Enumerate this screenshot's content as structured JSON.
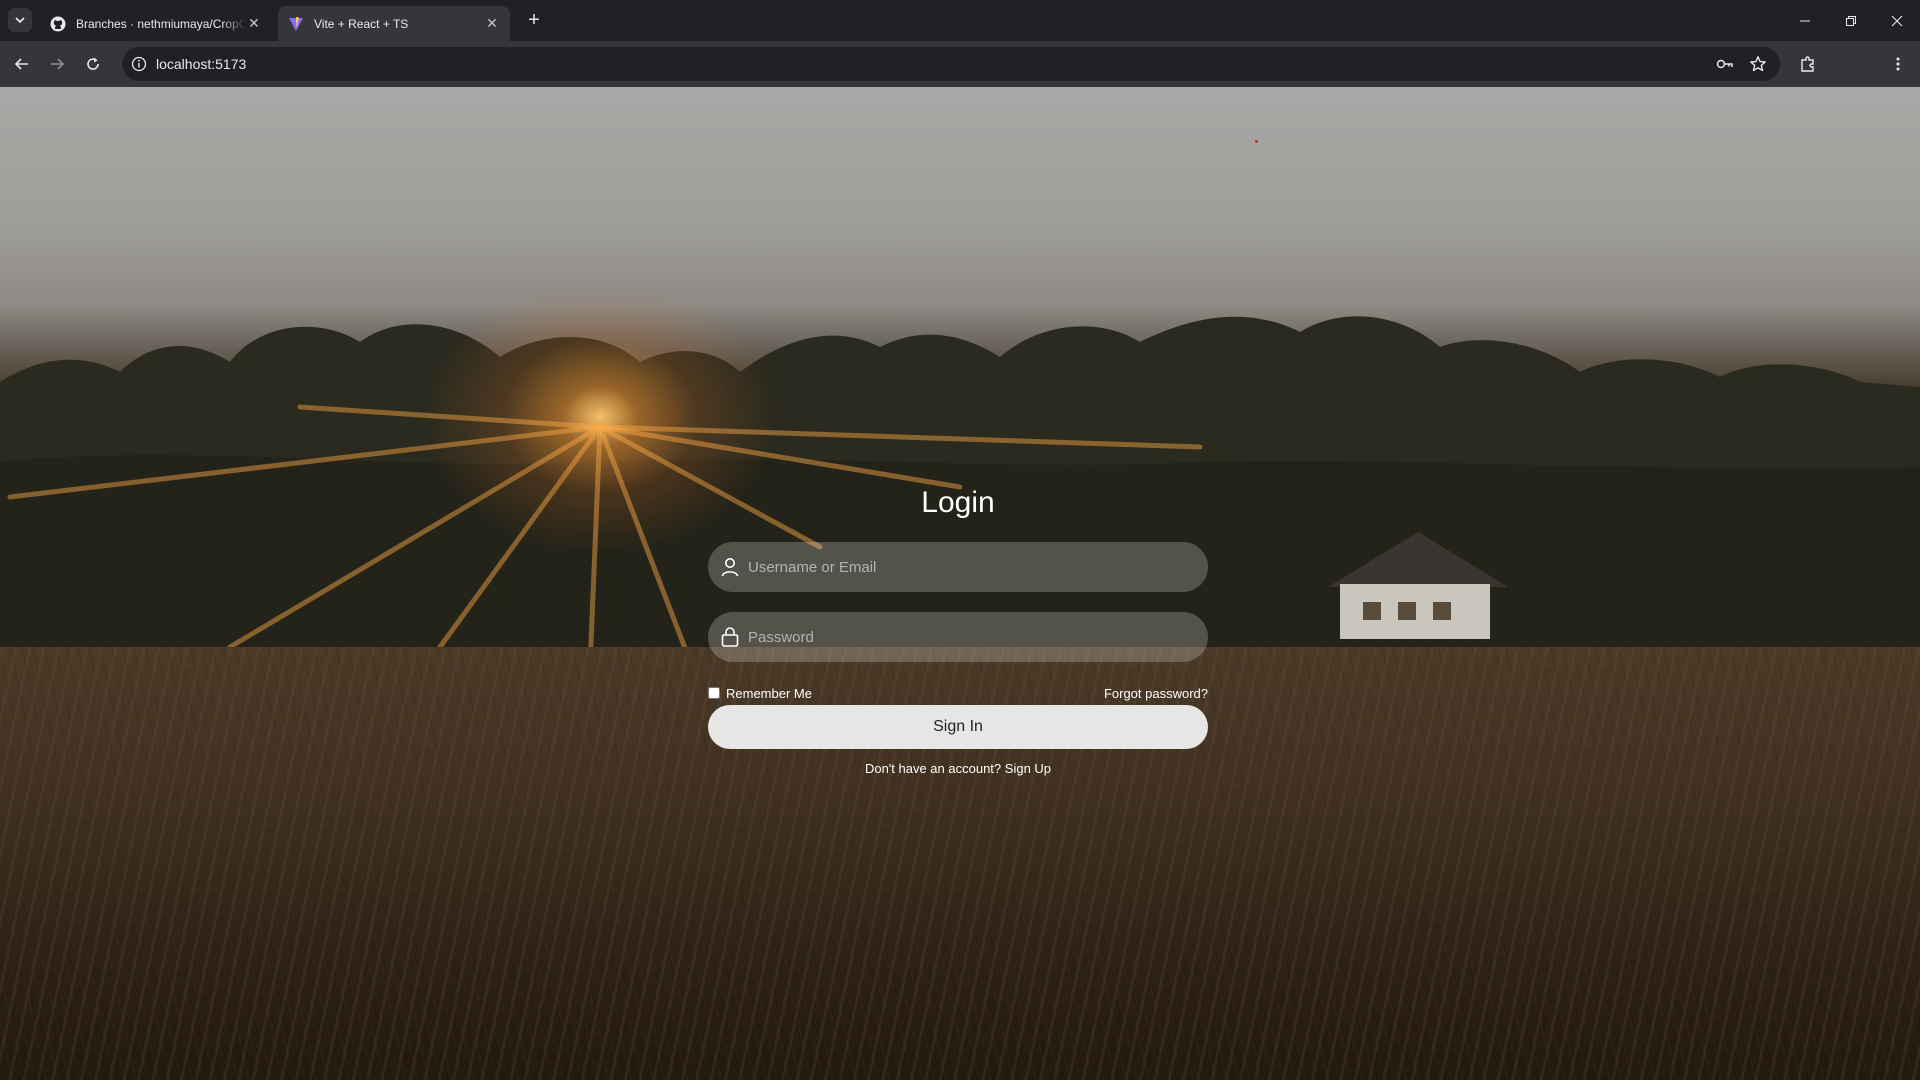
{
  "browser": {
    "tabs": [
      {
        "title": "Branches · nethmiumaya/CropC",
        "active": false
      },
      {
        "title": "Vite + React + TS",
        "active": true
      }
    ],
    "url": "localhost:5173"
  },
  "login": {
    "title": "Login",
    "username_placeholder": "Username or Email",
    "password_placeholder": "Password",
    "remember_label": "Remember Me",
    "forgot_label": "Forgot password?",
    "signin_label": "Sign In",
    "signup_prompt": "Don't have an account?",
    "signup_link": "Sign Up"
  },
  "icons": {
    "tab_search": "chevron-down-icon",
    "back": "arrow-left-icon",
    "forward": "arrow-right-icon",
    "reload": "reload-icon",
    "site_info": "info-icon",
    "password_key": "key-icon",
    "bookmark": "star-icon",
    "extensions": "puzzle-icon",
    "menu": "kebab-menu-icon",
    "user_field": "user-icon",
    "password_field": "lock-icon"
  },
  "colors": {
    "chrome_dark": "#202124",
    "chrome_toolbar": "#35363a",
    "signin_bg": "#e6e6e4"
  }
}
